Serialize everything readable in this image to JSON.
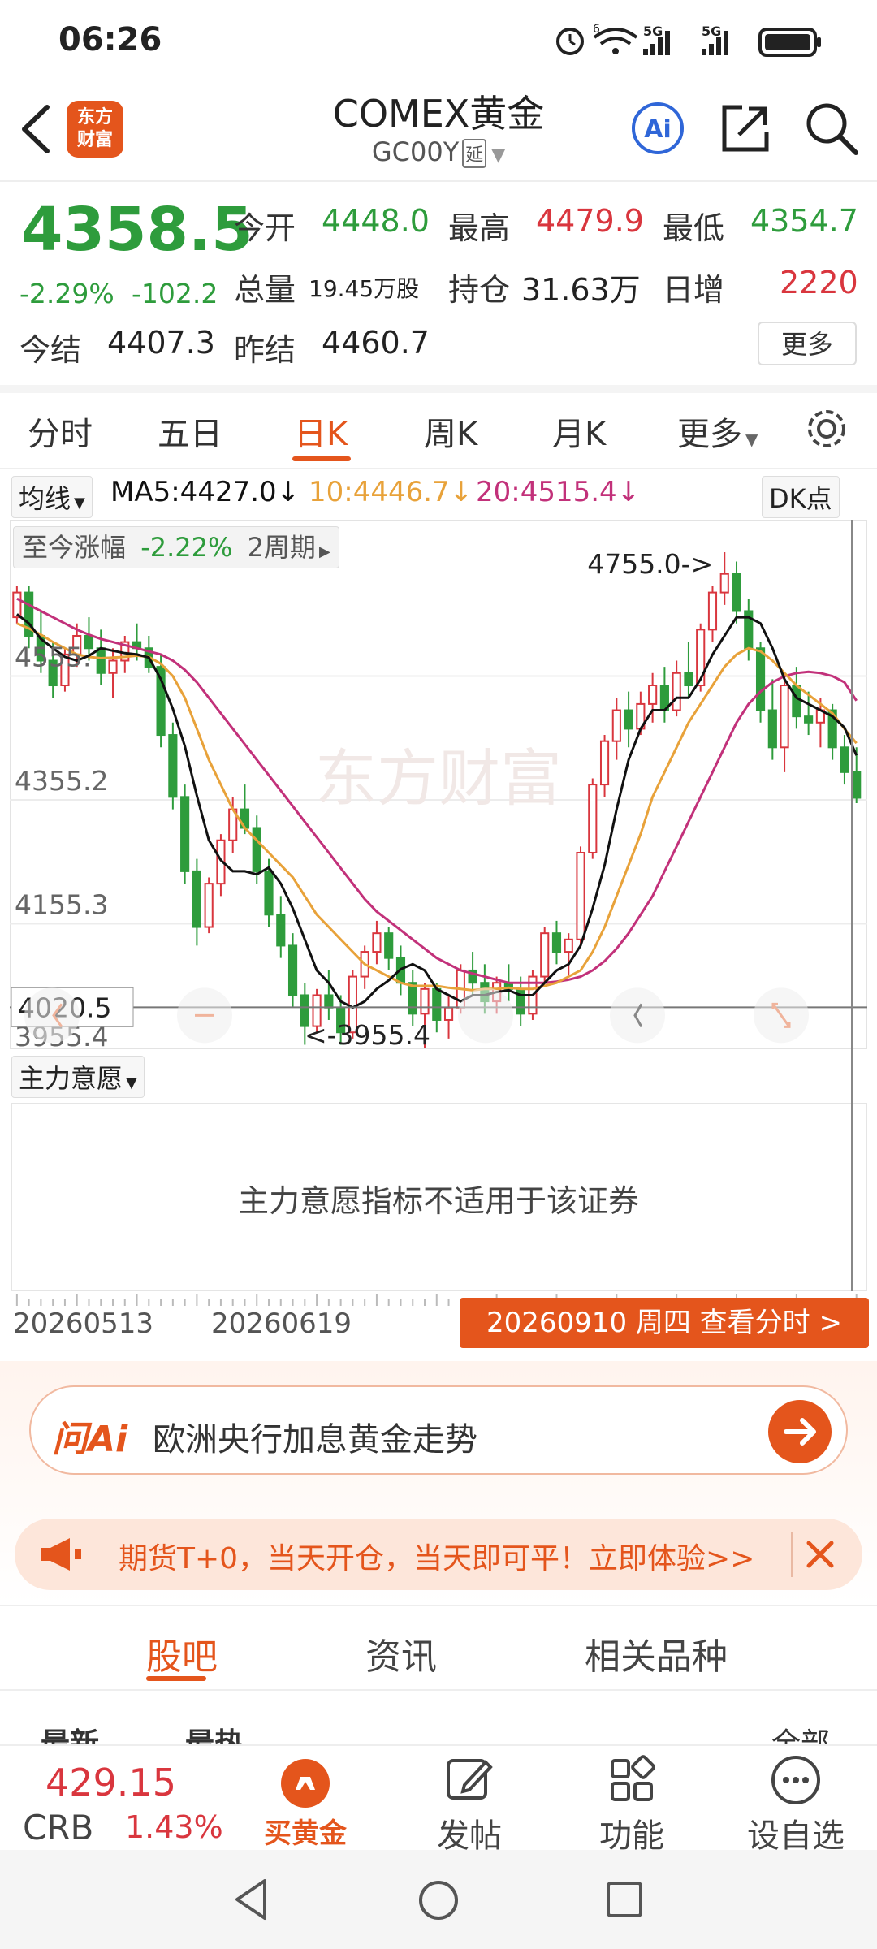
{
  "status_bar": {
    "time": "06:26",
    "signal1": "5G",
    "signal2": "5G",
    "wifi_badge": "6"
  },
  "header": {
    "back_icon": "chevron-left-icon",
    "logo_text_1": "东方",
    "logo_text_2": "财富",
    "title": "COMEX黄金",
    "code": "GC00Y",
    "delay_tag": "延",
    "ai_icon": "ai-icon",
    "share_icon": "share-icon",
    "search_icon": "search-icon"
  },
  "quote": {
    "price": "4358.5",
    "change_pct": "-2.29%",
    "change": "-102.2",
    "open_label": "今开",
    "open": "4448.0",
    "high_label": "最高",
    "high": "4479.9",
    "low_label": "最低",
    "low": "4354.7",
    "volume_label": "总量",
    "volume": "19.45万股",
    "oi_label": "持仓",
    "oi": "31.63万",
    "daily_inc_label": "日增",
    "daily_inc": "2220",
    "settle_label": "今结",
    "settle": "4407.3",
    "prev_settle_label": "昨结",
    "prev_settle": "4460.7",
    "more": "更多"
  },
  "tabs": [
    {
      "label": "分时"
    },
    {
      "label": "五日"
    },
    {
      "label": "日K"
    },
    {
      "label": "周K"
    },
    {
      "label": "月K"
    },
    {
      "label": "更多"
    }
  ],
  "active_tab": "日K",
  "ma_row": {
    "selector": "均线",
    "ma5": "MA5:4427.0",
    "ma10": "10:4446.7",
    "ma20": "20:4515.4",
    "dk": "DK点",
    "arrow": "↓"
  },
  "colors": {
    "up": "#d9363e",
    "down": "#2e9c3c",
    "ma5": "#111111",
    "ma10": "#e8a23a",
    "ma20": "#c2317a",
    "accent": "#e4551c"
  },
  "chart_data": {
    "type": "candlestick",
    "y_axis_labels": [
      "4555.",
      "4355.2",
      "4155.3",
      "3955.4"
    ],
    "ylim": [
      3955.4,
      4755.0
    ],
    "crosshair_value": "4020.5",
    "range_badge": {
      "label": "至今涨幅",
      "value": "-2.22%",
      "period": "2周期"
    },
    "annotations": {
      "high": "4755.0->",
      "low": "<-3955.4"
    },
    "watermark": "东方财富",
    "candles": [
      [
        4650,
        4700,
        4640,
        4690
      ],
      [
        4690,
        4700,
        4600,
        4620
      ],
      [
        4620,
        4660,
        4560,
        4580
      ],
      [
        4580,
        4610,
        4520,
        4540
      ],
      [
        4540,
        4600,
        4530,
        4590
      ],
      [
        4590,
        4640,
        4570,
        4620
      ],
      [
        4620,
        4650,
        4580,
        4600
      ],
      [
        4600,
        4630,
        4540,
        4560
      ],
      [
        4560,
        4600,
        4520,
        4580
      ],
      [
        4580,
        4620,
        4560,
        4610
      ],
      [
        4610,
        4640,
        4580,
        4600
      ],
      [
        4600,
        4620,
        4560,
        4570
      ],
      [
        4570,
        4590,
        4440,
        4460
      ],
      [
        4460,
        4480,
        4340,
        4360
      ],
      [
        4360,
        4380,
        4220,
        4240
      ],
      [
        4240,
        4260,
        4120,
        4150
      ],
      [
        4150,
        4230,
        4140,
        4220
      ],
      [
        4220,
        4300,
        4200,
        4290
      ],
      [
        4290,
        4360,
        4270,
        4340
      ],
      [
        4340,
        4380,
        4300,
        4310
      ],
      [
        4310,
        4330,
        4220,
        4240
      ],
      [
        4240,
        4260,
        4150,
        4170
      ],
      [
        4170,
        4200,
        4100,
        4120
      ],
      [
        4120,
        4140,
        4020,
        4040
      ],
      [
        4040,
        4060,
        3960,
        3990
      ],
      [
        3990,
        4050,
        3980,
        4040
      ],
      [
        4040,
        4080,
        4000,
        4020
      ],
      [
        4020,
        4040,
        3960,
        3980
      ],
      [
        3980,
        4080,
        3970,
        4070
      ],
      [
        4070,
        4120,
        4050,
        4110
      ],
      [
        4110,
        4160,
        4090,
        4140
      ],
      [
        4140,
        4150,
        4080,
        4100
      ],
      [
        4100,
        4120,
        4040,
        4060
      ],
      [
        4060,
        4080,
        3990,
        4010
      ],
      [
        4010,
        4060,
        3955.4,
        4050
      ],
      [
        4050,
        4060,
        3980,
        4000
      ],
      [
        4000,
        4040,
        3970,
        4020
      ],
      [
        4020,
        4090,
        4010,
        4080
      ],
      [
        4080,
        4110,
        4040,
        4060
      ],
      [
        4060,
        4090,
        4010,
        4030
      ],
      [
        4030,
        4070,
        4010,
        4060
      ],
      [
        4060,
        4090,
        4030,
        4050
      ],
      [
        4050,
        4070,
        3990,
        4010
      ],
      [
        4010,
        4080,
        4000,
        4070
      ],
      [
        4070,
        4150,
        4060,
        4140
      ],
      [
        4140,
        4160,
        4090,
        4110
      ],
      [
        4110,
        4140,
        4070,
        4130
      ],
      [
        4130,
        4280,
        4120,
        4270
      ],
      [
        4270,
        4390,
        4260,
        4380
      ],
      [
        4380,
        4460,
        4360,
        4450
      ],
      [
        4450,
        4520,
        4420,
        4500
      ],
      [
        4500,
        4530,
        4440,
        4470
      ],
      [
        4470,
        4530,
        4460,
        4510
      ],
      [
        4510,
        4560,
        4480,
        4540
      ],
      [
        4540,
        4570,
        4480,
        4500
      ],
      [
        4500,
        4580,
        4490,
        4560
      ],
      [
        4560,
        4610,
        4520,
        4540
      ],
      [
        4540,
        4640,
        4530,
        4630
      ],
      [
        4630,
        4700,
        4610,
        4690
      ],
      [
        4690,
        4755,
        4670,
        4720
      ],
      [
        4720,
        4740,
        4640,
        4660
      ],
      [
        4660,
        4680,
        4580,
        4600
      ],
      [
        4600,
        4610,
        4480,
        4500
      ],
      [
        4500,
        4550,
        4420,
        4440
      ],
      [
        4440,
        4560,
        4400,
        4540
      ],
      [
        4540,
        4570,
        4470,
        4490
      ],
      [
        4490,
        4530,
        4460,
        4480
      ],
      [
        4480,
        4520,
        4440,
        4500
      ],
      [
        4500,
        4510,
        4420,
        4440
      ],
      [
        4440,
        4460,
        4380,
        4400
      ],
      [
        4400,
        4440,
        4350,
        4358.5
      ]
    ],
    "ma5": [
      4655,
      4640,
      4615,
      4600,
      4586,
      4580,
      4588,
      4600,
      4596,
      4592,
      4590,
      4585,
      4550,
      4502,
      4442,
      4362,
      4290,
      4258,
      4240,
      4240,
      4235,
      4246,
      4220,
      4180,
      4130,
      4080,
      4060,
      4030,
      4020,
      4030,
      4050,
      4064,
      4082,
      4090,
      4080,
      4050,
      4040,
      4030,
      4040,
      4040,
      4045,
      4048,
      4040,
      4040,
      4060,
      4080,
      4090,
      4120,
      4180,
      4250,
      4340,
      4420,
      4470,
      4500,
      4500,
      4520,
      4520,
      4550,
      4590,
      4620,
      4650,
      4650,
      4640,
      4600,
      4550,
      4520,
      4510,
      4500,
      4490,
      4472,
      4427
    ],
    "ma10": [
      4640,
      4632,
      4622,
      4610,
      4600,
      4590,
      4586,
      4584,
      4585,
      4586,
      4588,
      4586,
      4575,
      4555,
      4520,
      4470,
      4420,
      4380,
      4340,
      4310,
      4290,
      4270,
      4250,
      4230,
      4200,
      4170,
      4150,
      4130,
      4110,
      4090,
      4080,
      4070,
      4060,
      4055,
      4055,
      4055,
      4052,
      4050,
      4048,
      4050,
      4050,
      4052,
      4050,
      4050,
      4055,
      4060,
      4070,
      4080,
      4110,
      4150,
      4200,
      4250,
      4300,
      4360,
      4400,
      4440,
      4480,
      4510,
      4540,
      4570,
      4590,
      4600,
      4595,
      4580,
      4560,
      4540,
      4525,
      4510,
      4495,
      4470,
      4446.7
    ],
    "ma20": [
      4680,
      4670,
      4660,
      4650,
      4640,
      4630,
      4622,
      4615,
      4610,
      4605,
      4600,
      4595,
      4590,
      4580,
      4565,
      4545,
      4520,
      4495,
      4470,
      4445,
      4420,
      4395,
      4370,
      4345,
      4320,
      4295,
      4270,
      4245,
      4220,
      4195,
      4175,
      4160,
      4145,
      4130,
      4115,
      4100,
      4090,
      4080,
      4075,
      4070,
      4065,
      4060,
      4060,
      4060,
      4060,
      4062,
      4065,
      4070,
      4080,
      4095,
      4115,
      4140,
      4170,
      4200,
      4240,
      4280,
      4320,
      4360,
      4400,
      4440,
      4480,
      4510,
      4530,
      4545,
      4555,
      4560,
      4562,
      4560,
      4555,
      4545,
      4515.4
    ]
  },
  "indicator": {
    "selector": "主力意愿",
    "message": "主力意愿指标不适用于该证券"
  },
  "dates": {
    "start": "20260513",
    "mid": "20260619",
    "current": "20260910 周四 查看分时 >"
  },
  "ai_bar": {
    "logo": "问Ai",
    "query": "欧洲央行加息黄金走势"
  },
  "promo": {
    "text": "期货T+0，当天开仓，当天即可平！立即体验>>"
  },
  "bottom_tabs": [
    {
      "label": "股吧"
    },
    {
      "label": "资讯"
    },
    {
      "label": "相关品种"
    }
  ],
  "feed_row": {
    "latest": "最新",
    "hot": "最热",
    "all": "全部"
  },
  "bottom_bar": {
    "index_value": "429.15",
    "index_name": "CRB",
    "index_change": "1.43%",
    "buy": "买黄金",
    "post": "发帖",
    "func": "功能",
    "watch": "设自选"
  }
}
